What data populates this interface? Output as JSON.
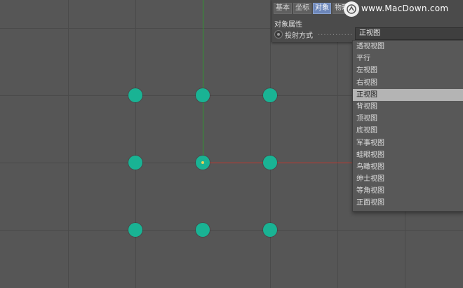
{
  "panel": {
    "tabs": [
      {
        "label": "基本",
        "active": false
      },
      {
        "label": "坐标",
        "active": false
      },
      {
        "label": "对象",
        "active": true
      },
      {
        "label": "物理",
        "active": false
      },
      {
        "label": "",
        "active": false
      },
      {
        "label": "",
        "active": false
      },
      {
        "label": "",
        "active": false
      }
    ],
    "title": "对象属性",
    "projection": {
      "label": "投射方式",
      "dots": "............",
      "value": "正视图"
    }
  },
  "watermark": {
    "text": "www.MacDown.com",
    "icon": "macdown-logo-icon"
  },
  "dropdown": {
    "options": [
      "透视视图",
      "平行",
      "左视图",
      "右视图",
      "正视图",
      "背视图",
      "顶视图",
      "底视图",
      "军事视图",
      "蛙眼视图",
      "鸟瞰视图",
      "绅士视图",
      "等角视图",
      "正面视图"
    ],
    "selected_index": 4
  },
  "viewport": {
    "point_color": "#19b394",
    "x_axis_color": "#c0382e",
    "y_axis_color": "#2e9a2e",
    "points_grid": "3x3"
  }
}
